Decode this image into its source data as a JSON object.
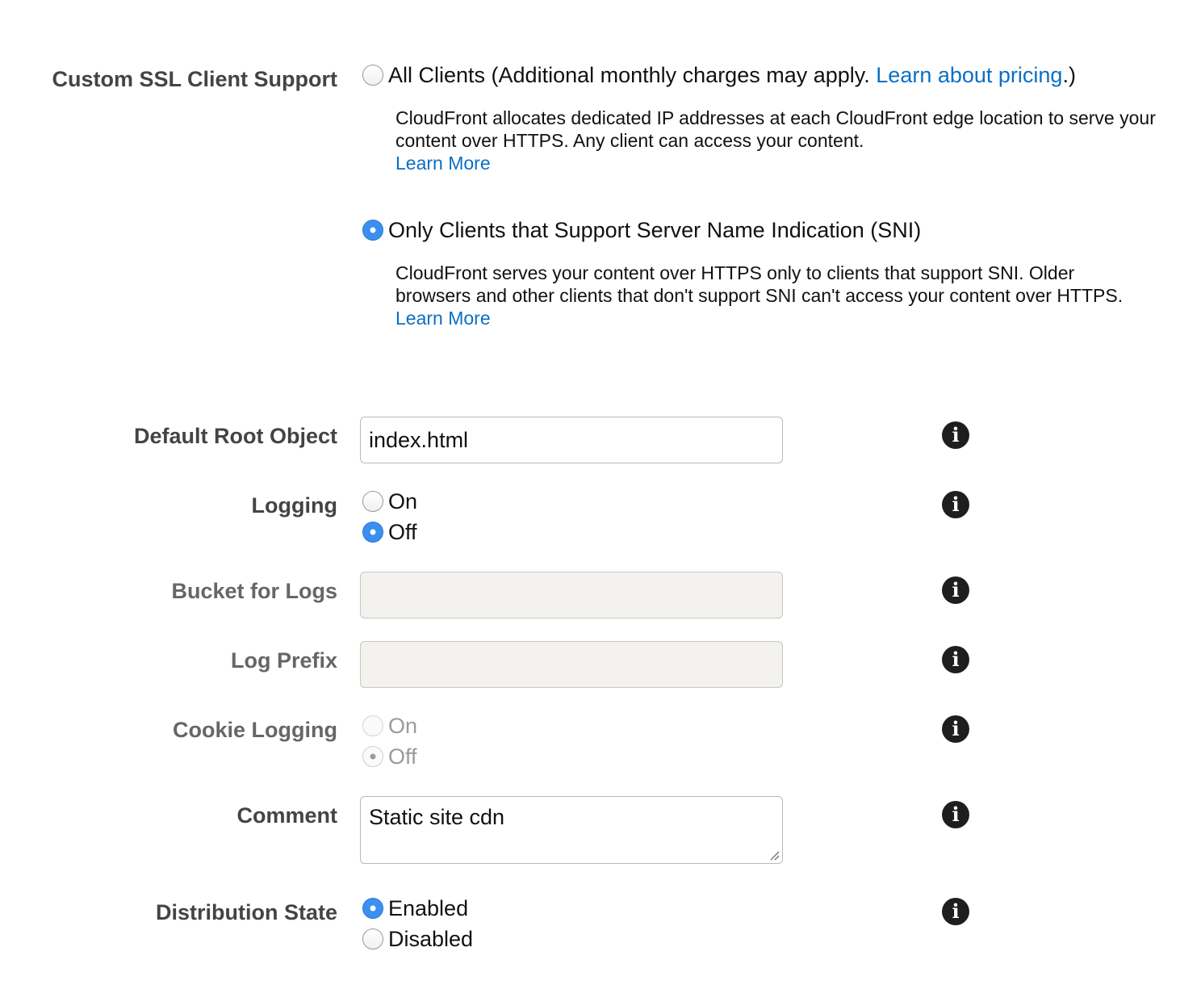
{
  "ssl": {
    "label": "Custom SSL Client Support",
    "option_all": {
      "text": "All Clients (Additional monthly charges may apply. ",
      "link": "Learn about pricing",
      "after": ".)",
      "checked": false,
      "description": "CloudFront allocates dedicated IP addresses at each CloudFront edge location to serve your content over HTTPS. Any client can access your content.",
      "learn_more": "Learn More"
    },
    "option_sni": {
      "text": "Only Clients that Support Server Name Indication (SNI)",
      "checked": true,
      "description": "CloudFront serves your content over HTTPS only to clients that support SNI. Older browsers and other clients that don't support SNI can't access your content over HTTPS.",
      "learn_more": "Learn More"
    }
  },
  "default_root_object": {
    "label": "Default Root Object",
    "value": "index.html"
  },
  "logging": {
    "label": "Logging",
    "on": "On",
    "off": "Off",
    "selected": "Off"
  },
  "bucket_for_logs": {
    "label": "Bucket for Logs",
    "value": ""
  },
  "log_prefix": {
    "label": "Log Prefix",
    "value": ""
  },
  "cookie_logging": {
    "label": "Cookie Logging",
    "on": "On",
    "off": "Off",
    "selected": "Off"
  },
  "comment": {
    "label": "Comment",
    "value": "Static site cdn"
  },
  "distribution_state": {
    "label": "Distribution State",
    "enabled": "Enabled",
    "disabled": "Disabled",
    "selected": "Enabled"
  },
  "info_glyph": "i",
  "colors": {
    "radio_checked": "#3b8ff0",
    "link": "#0b6fc4",
    "label": "#444444",
    "label_disabled": "#666666",
    "disabled_input_bg": "#f3f2ef"
  }
}
